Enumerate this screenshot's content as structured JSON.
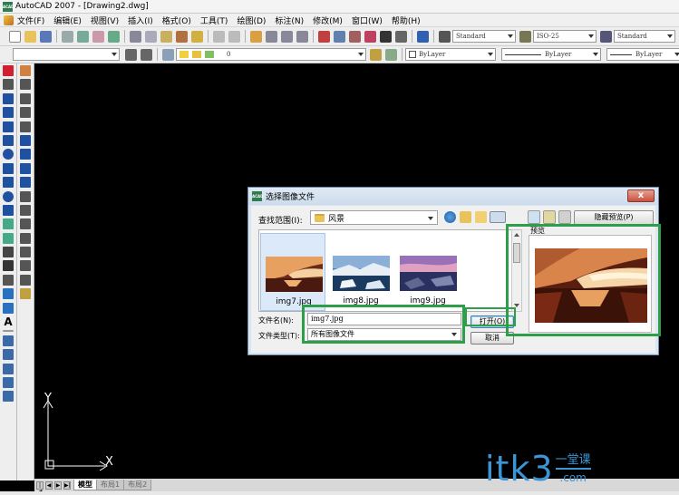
{
  "window": {
    "title": "AutoCAD 2007 - [Drawing2.dwg]",
    "app_icon": "ACAD"
  },
  "menu": [
    "文件(F)",
    "编辑(E)",
    "视图(V)",
    "插入(I)",
    "格式(O)",
    "工具(T)",
    "绘图(D)",
    "标注(N)",
    "修改(M)",
    "窗口(W)",
    "帮助(H)"
  ],
  "toolbar": {
    "text_style": "Standard",
    "dim_style": "ISO-25",
    "table_style": "Standard",
    "layer_value": "0",
    "color": "ByLayer",
    "linetype": "ByLayer",
    "lineweight": "ByLayer"
  },
  "canvas": {
    "axis_y": "Y",
    "axis_x": "X"
  },
  "layout_tabs": [
    "模型",
    "布局1",
    "布局2"
  ],
  "dialog": {
    "title": "选择图像文件",
    "close_label": "x",
    "look_in_label": "查找范围(I):",
    "look_in_value": "风景",
    "hide_preview_label": "隐藏预览(P)",
    "preview_label": "预览",
    "files": [
      {
        "name": "img7.jpg",
        "selected": true
      },
      {
        "name": "img8.jpg",
        "selected": false
      },
      {
        "name": "img9.jpg",
        "selected": false
      }
    ],
    "file_name_label": "文件名(N):",
    "file_name_value": "img7.jpg",
    "file_type_label": "文件类型(T):",
    "file_type_value": "所有图像文件",
    "open_label": "打开(O)",
    "cancel_label": "取消"
  },
  "watermark": {
    "main": "itk3",
    "side_top": "一堂课",
    "side_bottom": ".com"
  },
  "colors": {
    "highlight": "#2e9e48",
    "canvas": "#000000",
    "watermark": "#3c95d4"
  }
}
